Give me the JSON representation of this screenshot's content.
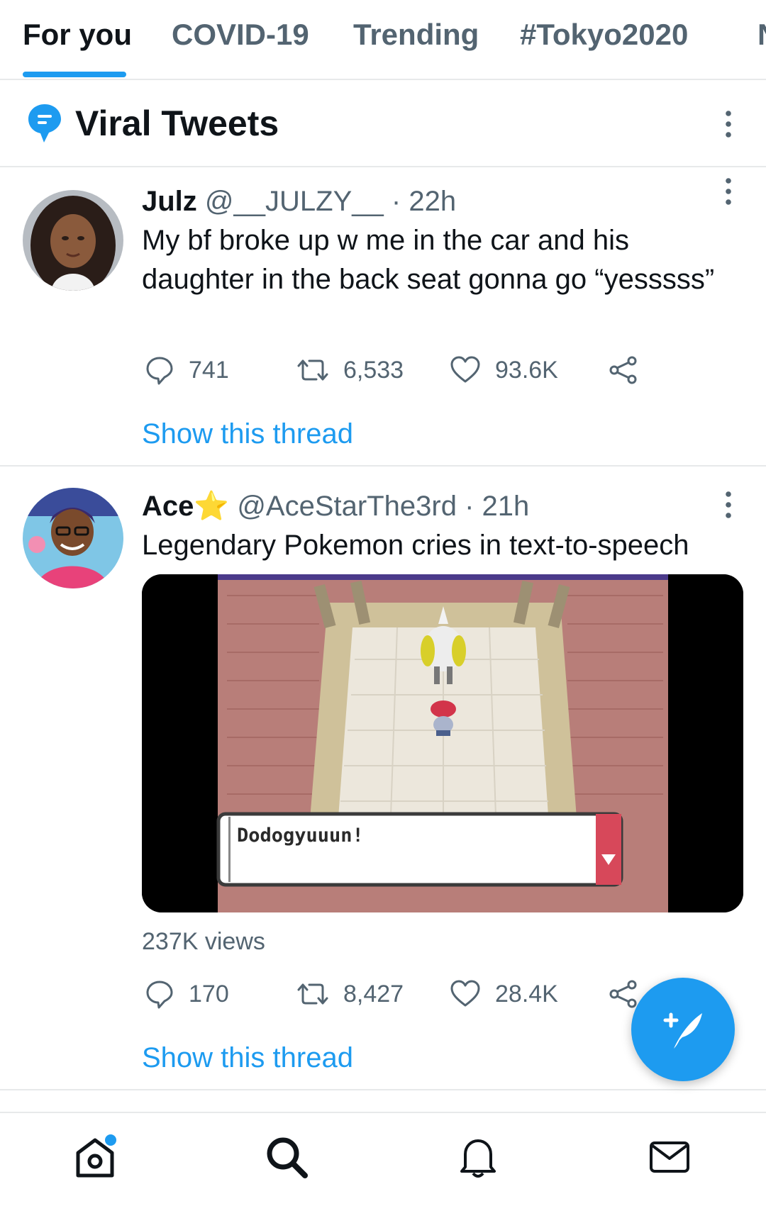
{
  "tabs": [
    {
      "label": "For you",
      "active": true
    },
    {
      "label": "COVID-19",
      "active": false
    },
    {
      "label": "Trending",
      "active": false
    },
    {
      "label": "#Tokyo2020",
      "active": false
    },
    {
      "label": "N",
      "active": false
    }
  ],
  "section": {
    "title": "Viral Tweets",
    "icon": "topic-bubble-icon"
  },
  "tweets": [
    {
      "display_name": "Julz",
      "handle": "@__JULZY__",
      "time": "· 22h",
      "text": "My bf broke up w me in the car and his daughter in the back seat gonna go “yesssss”",
      "replies": "741",
      "retweets": "6,533",
      "likes": "93.6K",
      "show_thread": "Show this thread"
    },
    {
      "display_name": "Ace",
      "name_emoji": "⭐",
      "handle": "@AceStarThe3rd",
      "time": "· 21h",
      "text": "Legendary Pokemon cries in text-to-speech",
      "media_caption": "Dodogyuuun!",
      "views": "237K views",
      "replies": "170",
      "retweets": "8,427",
      "likes": "28.4K",
      "show_thread": "Show this thread"
    }
  ],
  "fab": {
    "icon": "compose-tweet-icon"
  },
  "bottom_nav": [
    {
      "icon": "home-icon",
      "has_notification_dot": true
    },
    {
      "icon": "search-icon"
    },
    {
      "icon": "bell-icon"
    },
    {
      "icon": "mail-icon"
    }
  ],
  "colors": {
    "accent": "#1d9bf0",
    "text_primary": "#0f1419",
    "text_secondary": "#536471",
    "divider": "#e7e9ea"
  }
}
